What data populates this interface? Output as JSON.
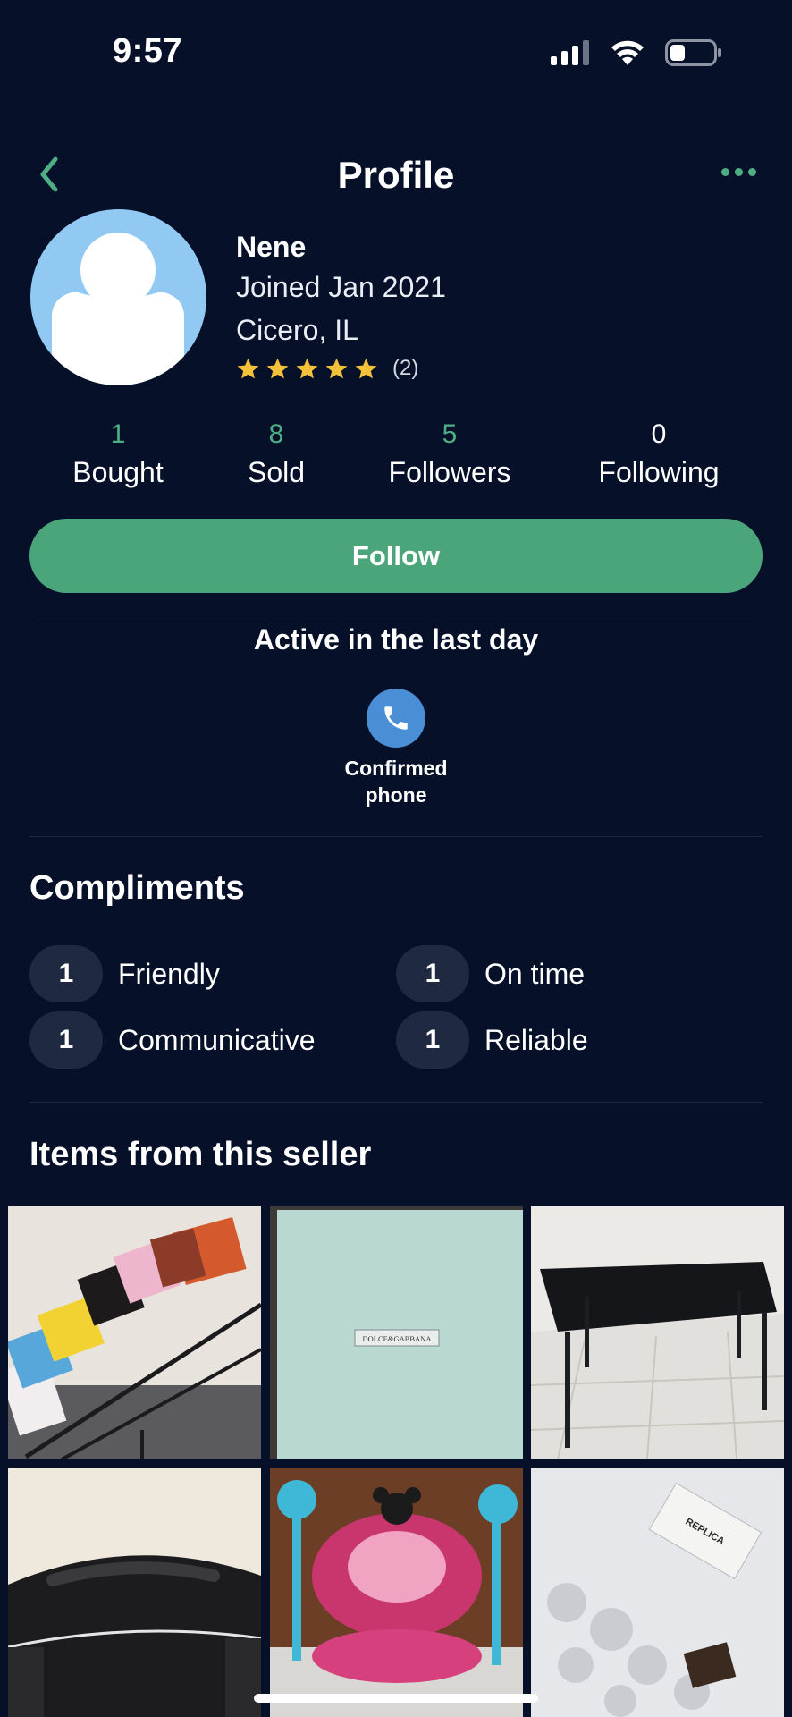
{
  "status_bar": {
    "time": "9:57",
    "signal_icon": "cellular-signal-icon",
    "wifi_icon": "wifi-icon",
    "battery_icon": "battery-icon",
    "battery_level": 0.3
  },
  "nav": {
    "title": "Profile",
    "back_icon": "chevron-left-icon",
    "more_icon": "more-options-icon"
  },
  "profile": {
    "name": "Nene",
    "joined": "Joined Jan 2021",
    "location": "Cicero, IL",
    "rating_stars": 5,
    "rating_count": "(2)"
  },
  "stats": [
    {
      "value": "1",
      "label": "Bought"
    },
    {
      "value": "8",
      "label": "Sold"
    },
    {
      "value": "5",
      "label": "Followers"
    },
    {
      "value": "0",
      "label": "Following"
    }
  ],
  "follow_button": "Follow",
  "activity": "Active in the last day",
  "verification": {
    "label_line1": "Confirmed",
    "label_line2": "phone",
    "icon": "phone-icon"
  },
  "compliments": {
    "title": "Compliments",
    "items": [
      {
        "count": "1",
        "label": "Friendly"
      },
      {
        "count": "1",
        "label": "On time"
      },
      {
        "count": "1",
        "label": "Communicative"
      },
      {
        "count": "1",
        "label": "Reliable"
      }
    ]
  },
  "items_section": {
    "title": "Items from this seller",
    "items": [
      {
        "name": "item-bags-photo"
      },
      {
        "name": "item-dolce-gabbana-box-photo",
        "text": "DOLCE&GABBANA"
      },
      {
        "name": "item-glass-table-photo"
      },
      {
        "name": "item-leather-sofa-photo"
      },
      {
        "name": "item-minnie-jumper-photo"
      },
      {
        "name": "item-replica-bag-photo",
        "text": "REPLICA"
      }
    ]
  },
  "colors": {
    "background": "#061029",
    "accent": "#4ba57b",
    "star": "#f3c13a",
    "phone_badge": "#4a8fd6"
  }
}
